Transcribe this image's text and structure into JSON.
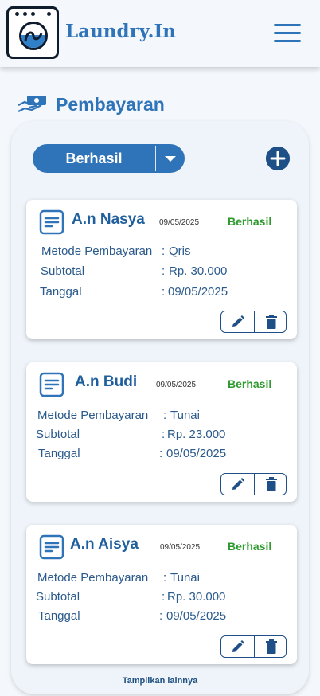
{
  "header": {
    "brand": "Laundry.In"
  },
  "page": {
    "title": "Pembayaran"
  },
  "filter": {
    "label": "Berhasil"
  },
  "labels": {
    "method": "Metode Pembayaran",
    "subtotal": "Subtotal",
    "date": "Tanggal",
    "colon": ":"
  },
  "payments": [
    {
      "name": "A.n Nasya",
      "date": "09/05/2025",
      "status": "Berhasil",
      "method": "Qris",
      "subtotal": "Rp. 30.000",
      "tanggal": "09/05/2025"
    },
    {
      "name": "A.n Budi",
      "date": "09/05/2025",
      "status": "Berhasil",
      "method": "Tunai",
      "subtotal": "Rp. 23.000",
      "tanggal": "09/05/2025"
    },
    {
      "name": "A.n Aisya",
      "date": "09/05/2025",
      "status": "Berhasil",
      "method": "Tunai",
      "subtotal": "Rp. 30.000",
      "tanggal": "09/05/2025"
    }
  ],
  "footer": {
    "show_more": "Tampilkan lainnya"
  },
  "colors": {
    "primary": "#2f74b8",
    "dark": "#1e4f86",
    "success": "#2e9a2e"
  },
  "icons": [
    "washing-machine-logo",
    "menu-icon",
    "payment-icon",
    "chevron-down-icon",
    "plus-icon",
    "document-icon",
    "edit-icon",
    "trash-icon"
  ]
}
